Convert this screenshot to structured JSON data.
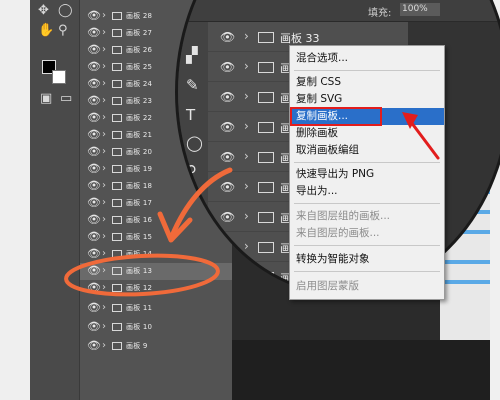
{
  "layers": [
    {
      "name": "画板 28"
    },
    {
      "name": "画板 27"
    },
    {
      "name": "画板 26"
    },
    {
      "name": "画板 25"
    },
    {
      "name": "画板 24"
    },
    {
      "name": "画板 23"
    },
    {
      "name": "画板 22"
    },
    {
      "name": "画板 21"
    },
    {
      "name": "画板 20"
    },
    {
      "name": "画板 19"
    },
    {
      "name": "画板 18"
    },
    {
      "name": "画板 17"
    },
    {
      "name": "画板 16"
    },
    {
      "name": "画板 15"
    },
    {
      "name": "画板 14"
    },
    {
      "name": "画板 13"
    },
    {
      "name": "画板 12"
    },
    {
      "name": "画板 11"
    },
    {
      "name": "画板 10"
    },
    {
      "name": "画板 9"
    }
  ],
  "magnified": {
    "fill_label": "填充:",
    "fill_value": "100%",
    "rows": [
      {
        "name": "画板 33"
      },
      {
        "name": "画板"
      },
      {
        "name": "画板"
      },
      {
        "name": "画板"
      },
      {
        "name": "画板"
      },
      {
        "name": "画板"
      },
      {
        "name": "画板"
      },
      {
        "name": "画板"
      },
      {
        "name": "画板"
      },
      {
        "name": "画板"
      }
    ]
  },
  "context_menu": {
    "blending_options": "混合选项...",
    "copy_css": "复制 CSS",
    "copy_svg": "复制 SVG",
    "duplicate_artboard": "复制画板...",
    "delete_artboard": "删除画板",
    "ungroup_artboards": "取消画板编组",
    "quick_export_png": "快速导出为 PNG",
    "export_as": "导出为...",
    "artboard_from_group": "来自图层组的画板...",
    "artboard_from_layers": "来自图层的画板...",
    "convert_smart_object": "转换为智能对象",
    "enable_layer_effects": "启用图层蒙版"
  },
  "annotation_colors": {
    "highlight": "#e21d1d",
    "circle": "#f06a3a",
    "menu_selection": "#2a6fc9"
  }
}
